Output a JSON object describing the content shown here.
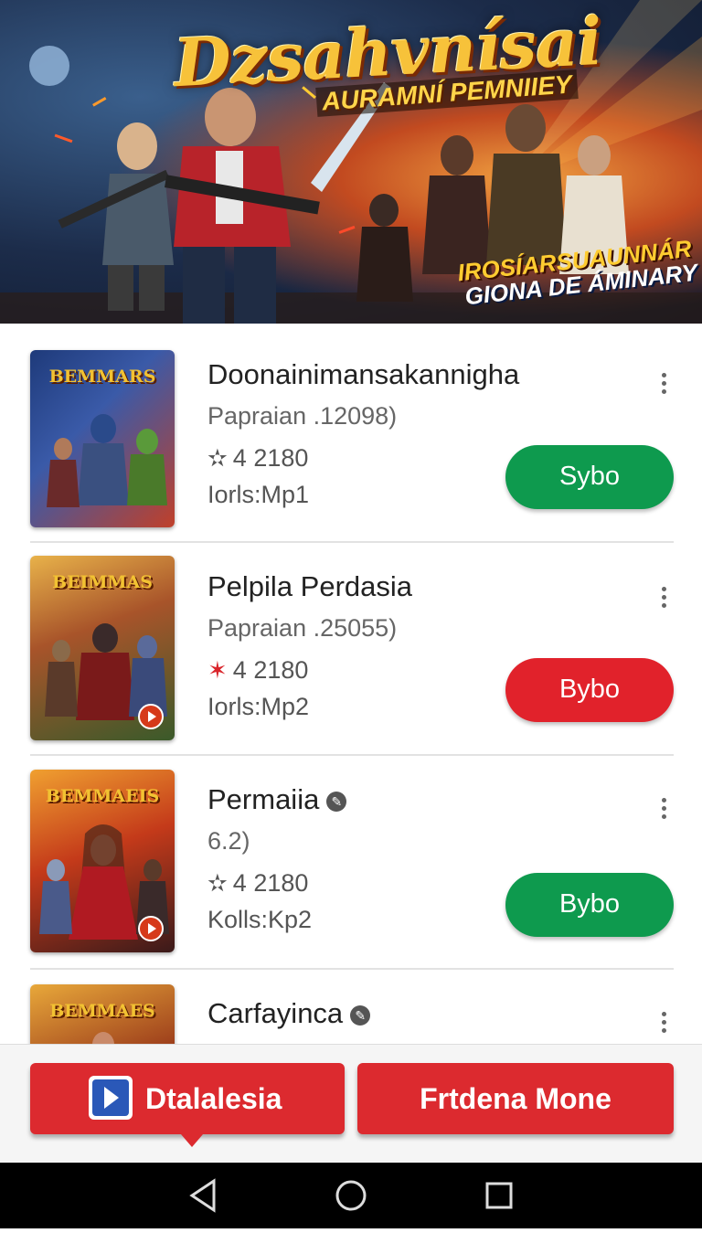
{
  "banner": {
    "title": "Dzsahvnísai",
    "subtitle": "AURAMNÍ PEMNIIEY",
    "tagline_line1": "IROSÍARSUAUNNÁR",
    "tagline_line2": "GIONA DE ÁMINARY"
  },
  "games": [
    {
      "title": "Doonainimansakannigha",
      "subtitle": "Papraian .12098)",
      "rating": "4 2180",
      "meta": "Iorls:Mp1",
      "button": "Sybo",
      "button_color": "#0e9a4e",
      "star_color": "#555555",
      "thumb_label": "BEMMARS",
      "verified": false
    },
    {
      "title": "Pelpila Perdasia",
      "subtitle": "Papraian .25055)",
      "rating": "4 2180",
      "meta": "Iorls:Mp2",
      "button": "Bybo",
      "button_color": "#e1222b",
      "star_color": "#d9252b",
      "thumb_label": "BEIMMAS",
      "verified": false
    },
    {
      "title": "Permaiia",
      "subtitle": "6.2)",
      "rating": "4 2180",
      "meta": "Kolls:Kp2",
      "button": "Bybo",
      "button_color": "#0e9a4e",
      "star_color": "#555555",
      "thumb_label": "BEMMAEIS",
      "verified": true
    },
    {
      "title": "Carfayinca",
      "thumb_label": "BEMMAES",
      "verified": true
    }
  ],
  "bottom_bar": {
    "left_label": "Dtalalesia",
    "right_label": "Frtdena Mone"
  }
}
